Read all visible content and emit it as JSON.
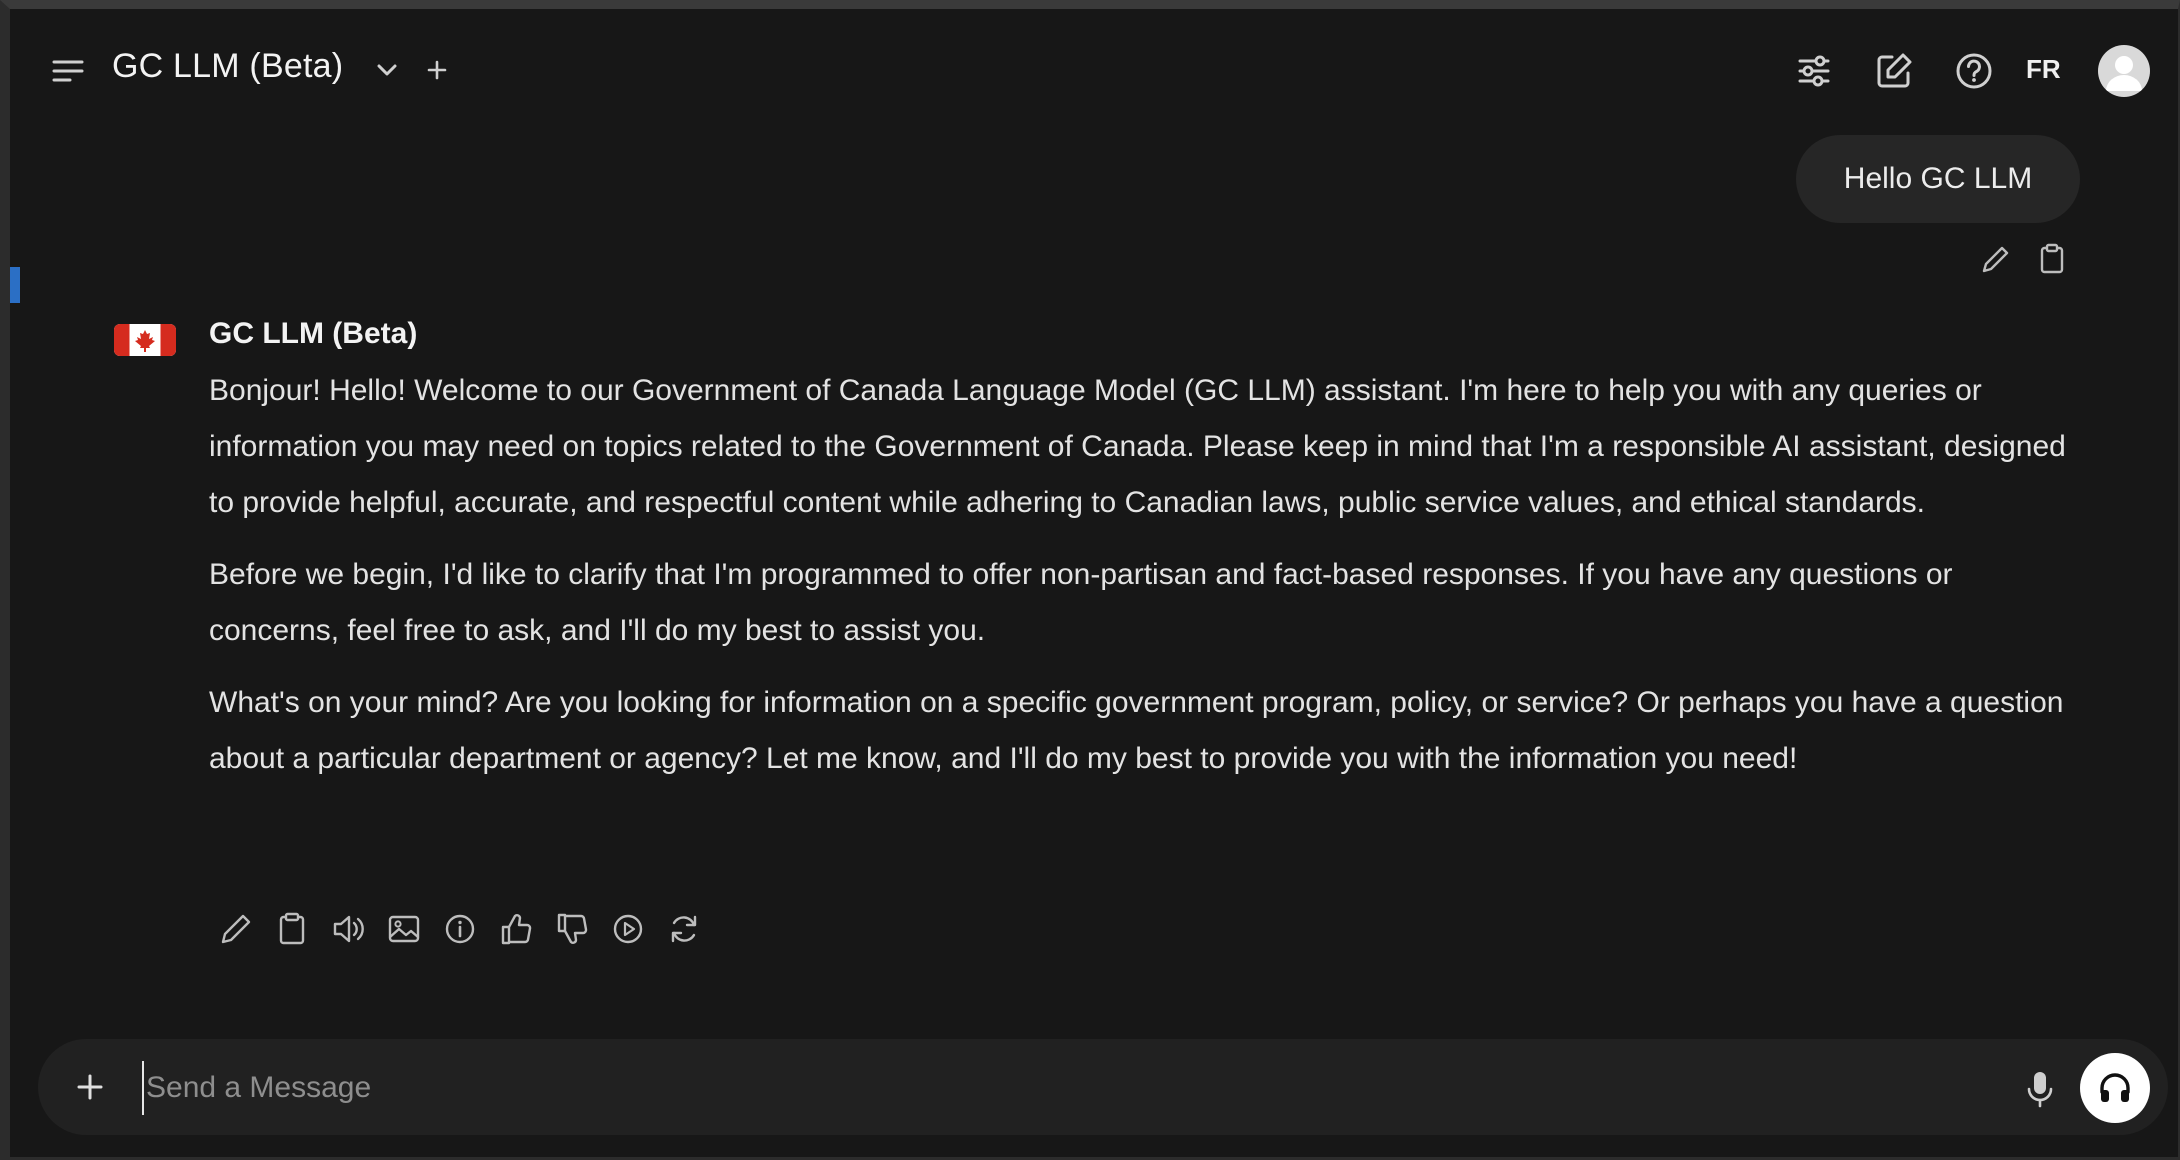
{
  "header": {
    "title": "GC LLM (Beta)",
    "language_toggle": "FR"
  },
  "icons": {
    "menu": "menu-icon",
    "model_dropdown": "chevron-down-icon",
    "new_tab": "plus-icon",
    "controls": "sliders-icon",
    "new_chat": "edit-icon",
    "help": "help-icon",
    "avatar": "user-avatar-icon"
  },
  "conversation": {
    "user_message": "Hello GC LLM",
    "assistant": {
      "name": "GC LLM (Beta)",
      "paragraphs": [
        "Bonjour! Hello! Welcome to our Government of Canada Language Model (GC LLM) assistant. I'm here to help you with any queries or information you may need on topics related to the Government of Canada. Please keep in mind that I'm a responsible AI assistant, designed to provide helpful, accurate, and respectful content while adhering to Canadian laws, public service values, and ethical standards.",
        "Before we begin, I'd like to clarify that I'm programmed to offer non-partisan and fact-based responses. If you have any questions or concerns, feel free to ask, and I'll do my best to assist you.",
        "What's on your mind? Are you looking for information on a specific government program, policy, or service? Or perhaps you have a question about a particular department or agency? Let me know, and I'll do my best to provide you with the information you need!"
      ]
    }
  },
  "composer": {
    "placeholder": "Send a Message",
    "value": ""
  },
  "colors": {
    "background": "#171717",
    "bubble": "#262626",
    "composer": "#212121",
    "flag_red": "#d52b1e"
  }
}
